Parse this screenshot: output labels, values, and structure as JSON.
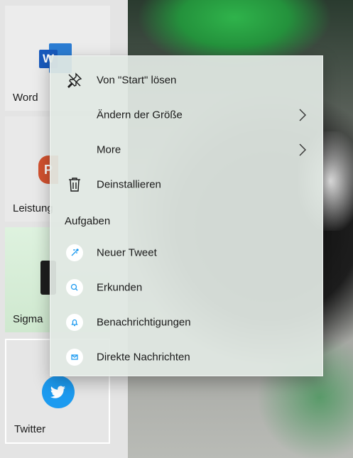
{
  "tiles": [
    {
      "label": "Word"
    },
    {
      "label": "Leistung"
    },
    {
      "label": "Sigma"
    },
    {
      "label": "Twitter"
    }
  ],
  "word_logo_letter": "W",
  "ppt_logo_letter": "P",
  "menu": {
    "items": [
      {
        "label": "Von \"Start\" lösen",
        "icon": "unpin-icon"
      },
      {
        "label": "Ändern der Größe",
        "icon": "chevron-right-icon"
      },
      {
        "label": "More",
        "icon": "chevron-right-icon"
      },
      {
        "label": "Deinstallieren",
        "icon": "trash-icon"
      }
    ],
    "section_title": "Aufgaben",
    "tasks": [
      {
        "label": "Neuer Tweet",
        "icon": "compose-icon"
      },
      {
        "label": "Erkunden",
        "icon": "search-icon"
      },
      {
        "label": "Benachrichtigungen",
        "icon": "bell-icon"
      },
      {
        "label": "Direkte Nachrichten",
        "icon": "mail-icon"
      }
    ]
  },
  "colors": {
    "accent_blue": "#1d9bf0",
    "word_blue": "#2b7cd3",
    "ppt_orange": "#d35230"
  }
}
